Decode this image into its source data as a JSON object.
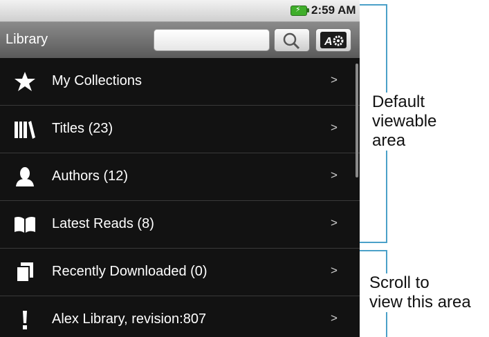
{
  "status_bar": {
    "time": "2:59 AM",
    "battery_icon": "battery-charging-icon"
  },
  "title_bar": {
    "title": "Library",
    "search_placeholder": "",
    "search_button_icon": "search-icon",
    "settings_button_icon": "settings-icon"
  },
  "list": {
    "items": [
      {
        "label": "My Collections",
        "icon": "star-icon",
        "chevron": ">"
      },
      {
        "label": "Titles (23)",
        "icon": "books-icon",
        "chevron": ">"
      },
      {
        "label": "Authors (12)",
        "icon": "person-icon",
        "chevron": ">"
      },
      {
        "label": "Latest Reads (8)",
        "icon": "open-book-icon",
        "chevron": ">"
      },
      {
        "label": "Recently Downloaded (0)",
        "icon": "stacked-pages-icon",
        "chevron": ">"
      },
      {
        "label": "Alex Library, revision:807",
        "icon": "exclamation-icon",
        "chevron": ">"
      }
    ]
  },
  "annotations": {
    "default_area": [
      "Default",
      "viewable",
      "area"
    ],
    "scroll_area": [
      "Scroll to",
      "view this area"
    ]
  },
  "colors": {
    "accent": "#4aa0c8",
    "battery": "#3fae2a"
  }
}
